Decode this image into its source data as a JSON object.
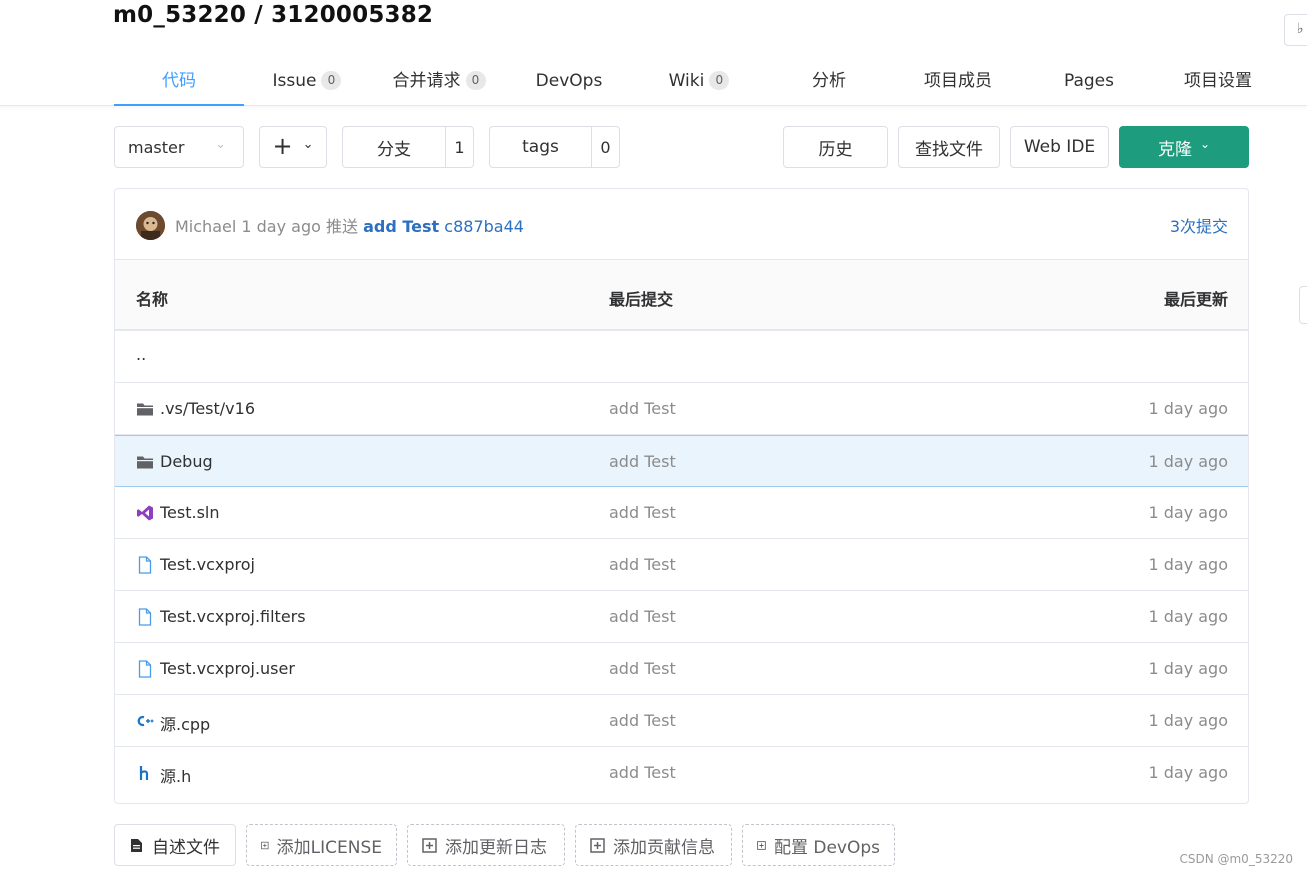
{
  "repo": {
    "title": "m0_53220 / 3120005382"
  },
  "nav": {
    "tabs": [
      {
        "label": "代码",
        "count": null
      },
      {
        "label": "Issue",
        "count": "0"
      },
      {
        "label": "合并请求",
        "count": "0"
      },
      {
        "label": "DevOps",
        "count": null
      },
      {
        "label": "Wiki",
        "count": "0"
      },
      {
        "label": "分析",
        "count": null
      },
      {
        "label": "项目成员",
        "count": null
      },
      {
        "label": "Pages",
        "count": null
      },
      {
        "label": "项目设置",
        "count": null
      }
    ]
  },
  "toolbar": {
    "branch": "master",
    "add_label": "+",
    "branches_label": "分支",
    "branches_count": "1",
    "tags_label": "tags",
    "tags_count": "0",
    "history_label": "历史",
    "find_file_label": "查找文件",
    "web_ide_label": "Web IDE",
    "clone_label": "克隆"
  },
  "commit": {
    "author": "Michael",
    "time": "1 day ago",
    "action": "推送",
    "message": "add Test",
    "sha": "c887ba44",
    "count_label": "3次提交"
  },
  "table": {
    "headers": {
      "name": "名称",
      "last_commit": "最后提交",
      "last_update": "最后更新"
    },
    "parent": "..",
    "rows": [
      {
        "icon": "folder-icon",
        "name": ".vs/Test/v16",
        "commit": "add Test",
        "time": "1 day ago"
      },
      {
        "icon": "folder-icon",
        "name": "Debug",
        "commit": "add Test",
        "time": "1 day ago"
      },
      {
        "icon": "visual-studio-icon",
        "name": "Test.sln",
        "commit": "add Test",
        "time": "1 day ago"
      },
      {
        "icon": "file-icon",
        "name": "Test.vcxproj",
        "commit": "add Test",
        "time": "1 day ago"
      },
      {
        "icon": "file-icon",
        "name": "Test.vcxproj.filters",
        "commit": "add Test",
        "time": "1 day ago"
      },
      {
        "icon": "file-icon",
        "name": "Test.vcxproj.user",
        "commit": "add Test",
        "time": "1 day ago"
      },
      {
        "icon": "cpp-icon",
        "name": "源.cpp",
        "commit": "add Test",
        "time": "1 day ago"
      },
      {
        "icon": "header-file-icon",
        "name": "源.h",
        "commit": "add Test",
        "time": "1 day ago"
      }
    ]
  },
  "actions": {
    "readme": "自述文件",
    "add_license": "添加LICENSE",
    "add_changelog": "添加更新日志",
    "add_contributing": "添加贡献信息",
    "config_devops": "配置 DevOps"
  },
  "watermark": "CSDN @m0_53220",
  "colors": {
    "accent": "#409eff",
    "clone": "#1e9c7e",
    "link": "#2d6fc0",
    "hover_row": "#eaf4fc"
  }
}
